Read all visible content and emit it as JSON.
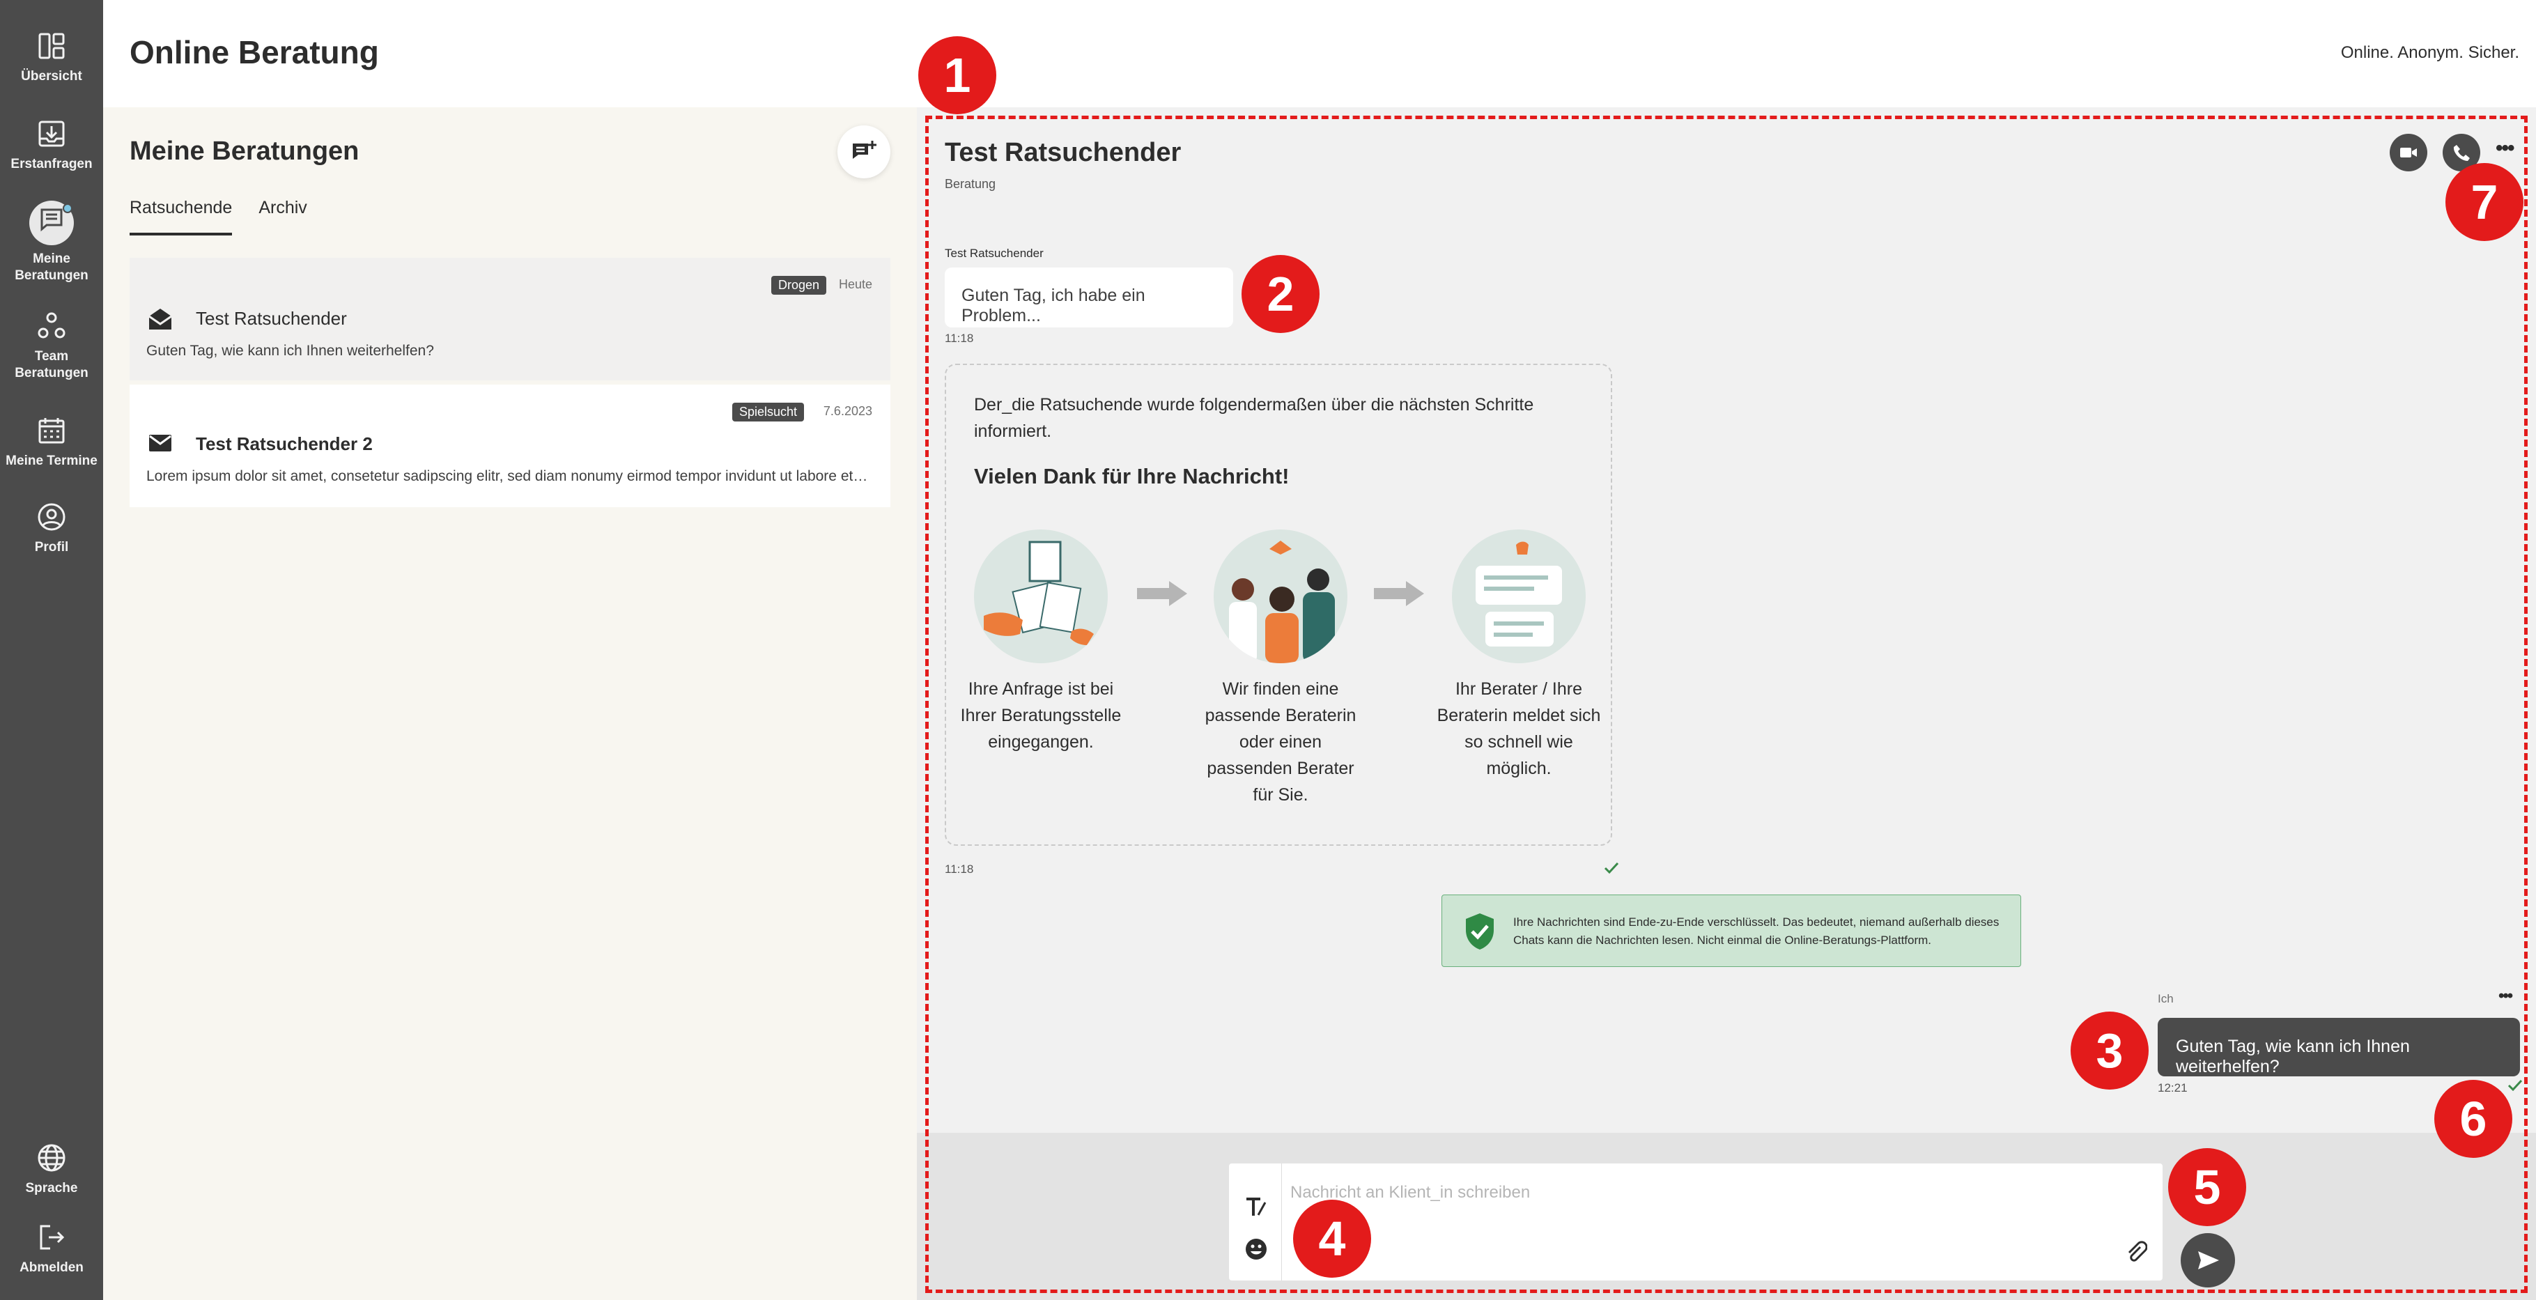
{
  "sidebar": {
    "items": [
      {
        "label": "Übersicht",
        "icon": "dashboard-icon"
      },
      {
        "label": "Erstanfragen",
        "icon": "inbox-download-icon"
      },
      {
        "label": "Meine Beratungen",
        "icon": "chat-bubble-icon"
      },
      {
        "label": "Team Beratungen",
        "icon": "team-icon"
      },
      {
        "label": "Meine Termine",
        "icon": "calendar-icon"
      },
      {
        "label": "Profil",
        "icon": "user-icon"
      }
    ],
    "bottom_items": [
      {
        "label": "Sprache",
        "icon": "globe-icon"
      },
      {
        "label": "Abmelden",
        "icon": "logout-icon"
      }
    ]
  },
  "header": {
    "title": "Online Beratung",
    "tagline": "Online. Anonym. Sicher."
  },
  "list": {
    "title": "Meine Beratungen",
    "tabs": [
      "Ratsuchende",
      "Archiv"
    ],
    "active_tab": "Ratsuchende",
    "sessions": [
      {
        "badge": "Drogen",
        "date": "Heute",
        "name": "Test Ratsuchender",
        "preview": "Guten Tag, wie kann ich Ihnen weiterhelfen?",
        "read": true
      },
      {
        "badge": "Spielsucht",
        "date": "7.6.2023",
        "name": "Test Ratsuchender 2",
        "preview": "Lorem ipsum dolor sit amet, consetetur sadipscing elitr, sed diam nonumy eirmod tempor invidunt ut labore et dolore magna aliquyam erat",
        "read": false
      }
    ]
  },
  "chat": {
    "title": "Test Ratsuchender",
    "subtitle": "Beratung",
    "messages": {
      "incoming_sender": "Test Ratsuchender",
      "incoming_text": "Guten Tag, ich habe ein Problem...",
      "incoming_time": "11:18",
      "info_time": "11:18",
      "outgoing_sender": "Ich",
      "outgoing_text": "Guten Tag, wie kann ich Ihnen weiterhelfen?",
      "outgoing_time": "12:21"
    },
    "info_card": {
      "intro": "Der_die Ratsuchende wurde folgendermaßen über die nächsten Schritte informiert.",
      "heading": "Vielen Dank für Ihre Nachricht!",
      "steps": [
        "Ihre Anfrage ist bei Ihrer Beratungsstelle eingegangen.",
        "Wir finden eine passende Beraterin oder einen passenden Berater für Sie.",
        "Ihr Berater / Ihre Beraterin meldet sich so schnell wie möglich."
      ]
    },
    "e2e_notice": "Ihre Nachrichten sind Ende-zu-Ende verschlüsselt. Das bedeutet, niemand außerhalb dieses Chats kann die Nachrichten lesen. Nicht einmal die Online-Beratungs-Plattform.",
    "composer": {
      "placeholder": "Nachricht an Klient_in schreiben",
      "value": ""
    }
  },
  "annotations": [
    "1",
    "2",
    "3",
    "4",
    "5",
    "6",
    "7"
  ],
  "colors": {
    "sidebar": "#4b4b4b",
    "list_background": "#f8f6f0",
    "chat_background": "#f1f1f1",
    "marker_red": "#e31b1b",
    "e2e_green": "#cde5d3",
    "badge": "#4b4b4b"
  }
}
